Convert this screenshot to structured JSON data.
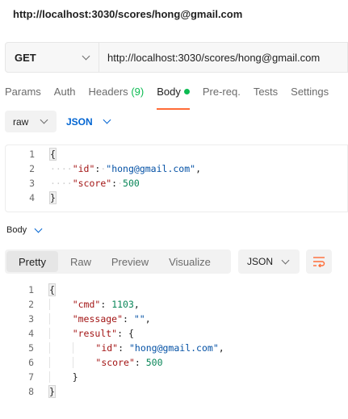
{
  "title": "http://localhost:3030/scores/hong@gmail.com",
  "request": {
    "method": "GET",
    "url": "http://localhost:3030/scores/hong@gmail.com"
  },
  "tabs": {
    "params": "Params",
    "auth": "Auth",
    "headers": "Headers",
    "headers_count": "(9)",
    "body": "Body",
    "prereq": "Pre-req.",
    "tests": "Tests",
    "settings": "Settings"
  },
  "body_options": {
    "mode": "raw",
    "language": "JSON"
  },
  "request_body": {
    "lines": [
      "1",
      "2",
      "3",
      "4"
    ],
    "open": "{",
    "key1": "\"id\"",
    "val1": "\"hong@gmail.com\"",
    "key2": "\"score\"",
    "val2": "500",
    "close": "}"
  },
  "response": {
    "label": "Body",
    "tabs": [
      "Pretty",
      "Raw",
      "Preview",
      "Visualize"
    ],
    "format": "JSON",
    "lines": [
      "1",
      "2",
      "3",
      "4",
      "5",
      "6",
      "7",
      "8"
    ],
    "open": "{",
    "cmd_key": "\"cmd\"",
    "cmd_val": "1103",
    "message_key": "\"message\"",
    "message_val": "\"\"",
    "result_key": "\"result\"",
    "result_open": "{",
    "id_key": "\"id\"",
    "id_val": "\"hong@gmail.com\"",
    "score_key": "\"score\"",
    "score_val": "500",
    "result_close": "}",
    "close": "}"
  },
  "colors": {
    "accent": "#ff6c37",
    "active_dot": "#0cbb52",
    "link_blue": "#0265d2"
  }
}
